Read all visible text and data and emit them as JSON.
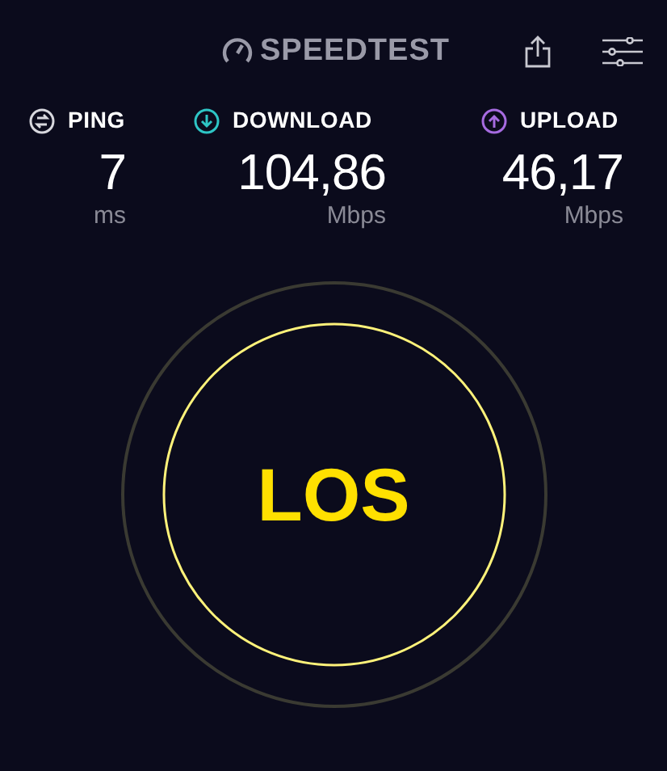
{
  "header": {
    "logo_text": "SPEEDTEST"
  },
  "metrics": [
    {
      "kind": "ping",
      "label": "PING",
      "value": "7",
      "unit": "ms",
      "color": "#d8d8de"
    },
    {
      "kind": "download",
      "label": "DOWNLOAD",
      "value": "104,86",
      "unit": "Mbps",
      "color": "#2ec5c5"
    },
    {
      "kind": "upload",
      "label": "UPLOAD",
      "value": "46,17",
      "unit": "Mbps",
      "color": "#a66be0"
    }
  ],
  "gauge": {
    "text": "LOS"
  }
}
